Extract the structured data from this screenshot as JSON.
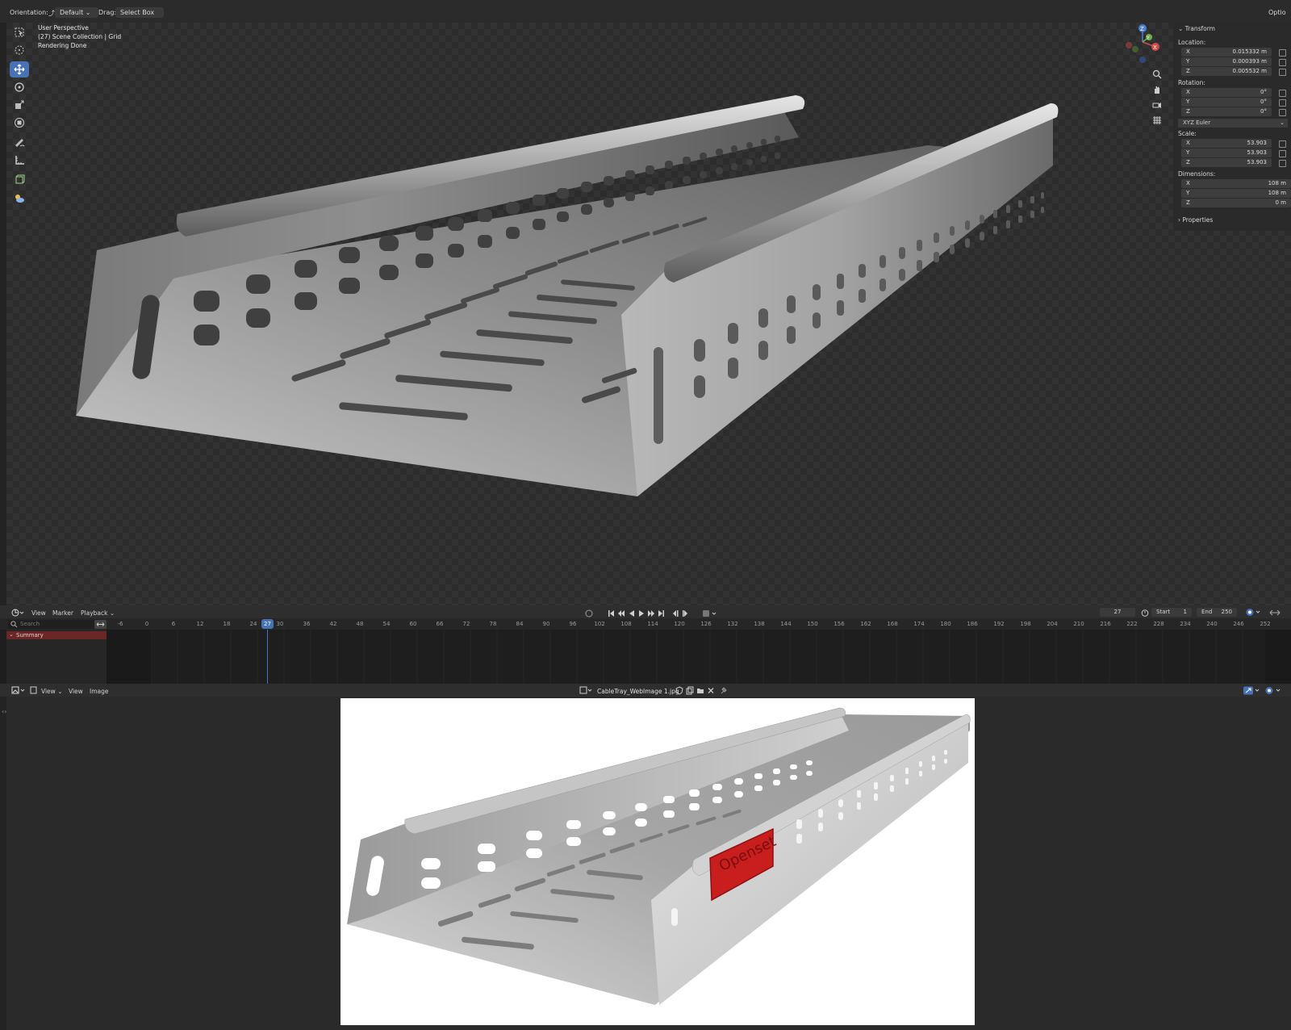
{
  "topbar": {
    "orientation_label": "Orientation:",
    "orientation_value": "Default",
    "drag_label": "Drag:",
    "drag_value": "Select Box"
  },
  "viewport": {
    "perspective": "User Perspective",
    "collection": "(27) Scene Collection | Grid",
    "status": "Rendering Done"
  },
  "npanel": {
    "section": "Transform",
    "location_label": "Location:",
    "location": [
      {
        "axis": "X",
        "value": "0.015332 m"
      },
      {
        "axis": "Y",
        "value": "0.000393 m"
      },
      {
        "axis": "Z",
        "value": "0.005532 m"
      }
    ],
    "rotation_label": "Rotation:",
    "rotation": [
      {
        "axis": "X",
        "value": "0°"
      },
      {
        "axis": "Y",
        "value": "0°"
      },
      {
        "axis": "Z",
        "value": "0°"
      }
    ],
    "rotation_mode": "XYZ Euler",
    "scale_label": "Scale:",
    "scale": [
      {
        "axis": "X",
        "value": "53.903"
      },
      {
        "axis": "Y",
        "value": "53.903"
      },
      {
        "axis": "Z",
        "value": "53.903"
      }
    ],
    "dimensions_label": "Dimensions:",
    "dimensions": [
      {
        "axis": "X",
        "value": "108 m"
      },
      {
        "axis": "Y",
        "value": "108 m"
      },
      {
        "axis": "Z",
        "value": "0 m"
      }
    ],
    "properties": "Properties",
    "options_tab": "Optio"
  },
  "gizmo": {
    "z": "Z",
    "y": "Y",
    "x": "X"
  },
  "timeline": {
    "menu": [
      "View",
      "Marker",
      "Playback"
    ],
    "current_frame": "27",
    "start_label": "Start",
    "start_value": "1",
    "end_label": "End",
    "end_value": "250",
    "search_placeholder": "Search",
    "summary": "Summary",
    "ticks": [
      "-6",
      "0",
      "6",
      "12",
      "18",
      "24",
      "30",
      "36",
      "42",
      "48",
      "54",
      "60",
      "66",
      "72",
      "78",
      "84",
      "90",
      "96",
      "102",
      "108",
      "114",
      "120",
      "126",
      "132",
      "138",
      "144",
      "150",
      "156",
      "162",
      "168",
      "174",
      "180",
      "186",
      "192",
      "198",
      "204",
      "210",
      "216",
      "222",
      "228",
      "234",
      "240",
      "246",
      "252"
    ],
    "playhead_label": "27"
  },
  "image_editor": {
    "menu": [
      "View",
      "View",
      "Image"
    ],
    "filename": "CableTray_WebImage 1.jpg",
    "logo_text": "Openset"
  },
  "colors": {
    "accent": "#4772b3",
    "summary_bg": "#6b2626",
    "logo_red": "#c81e1e"
  }
}
